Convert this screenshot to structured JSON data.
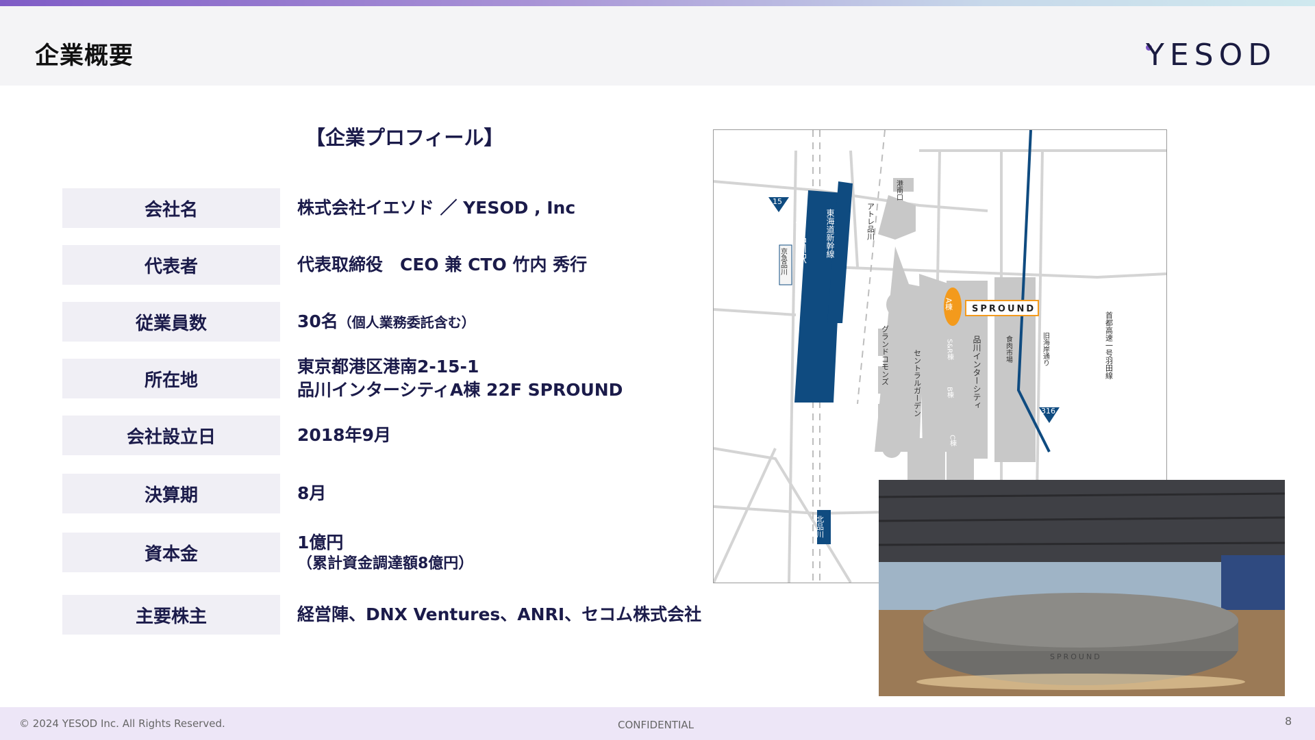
{
  "header": {
    "title": "企業概要",
    "logo_text": "YESOD"
  },
  "profile": {
    "heading": "【企業プロフィール】",
    "rows": [
      {
        "label": "会社名",
        "value": "株式会社イエソド ／ YESOD , Inc"
      },
      {
        "label": "代表者",
        "value": "代表取締役　CEO 兼 CTO 竹内 秀行"
      },
      {
        "label": "従業員数",
        "value": "30名",
        "note": "（個人業務委託含む）"
      },
      {
        "label": "所在地",
        "value": "東京都港区港南2-15-1",
        "value2": "品川インターシティA棟 22F SPROUND"
      },
      {
        "label": "会社設立日",
        "value": "2018年9月"
      },
      {
        "label": "決算期",
        "value": "8月"
      },
      {
        "label": "資本金",
        "value": "1億円",
        "value2": "（累計資金調達額8億円）"
      },
      {
        "label": "主要株主",
        "value": "経営陣、DNX Ventures、ANRI、セコム株式会社"
      }
    ]
  },
  "map": {
    "labels": {
      "jr_station": "JR品川駅",
      "keikyu": "京急品川",
      "shinkansen": "東海道新幹線",
      "atre": "アトレ品川",
      "konan": "港南口",
      "grand_commons": "グランドコモンズ",
      "central_garden": "セントラルガーデン",
      "a_tower": "A棟",
      "sr_tower": "S&R棟",
      "b_tower": "B棟",
      "c_tower": "C棟",
      "intercity": "品川インターシティ",
      "market": "食肉市場",
      "kyukaigan": "旧海岸通り",
      "expressway": "首都高速一号羽田線",
      "kitashinagawa": "北品川",
      "sign_15": "15",
      "sign_316": "316",
      "sprounds": "SPROUND"
    },
    "colors": {
      "rail_blue": "#0f4b80",
      "building_gray": "#c8c8c8",
      "highlight_orange": "#f39a1c"
    }
  },
  "photo": {
    "counter_logo": "SPROUND"
  },
  "footer": {
    "copyright": "© 2024 YESOD Inc. All Rights Reserved.",
    "confidential": "CONFIDENTIAL",
    "page_number": "8"
  }
}
